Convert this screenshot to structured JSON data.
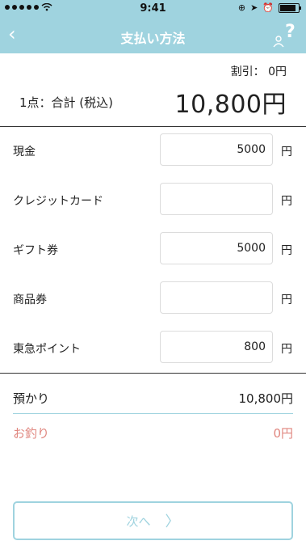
{
  "status_bar": {
    "time": "9:41"
  },
  "nav": {
    "back": "‹",
    "title": "支払い方法",
    "help": "?"
  },
  "summary": {
    "discount": "割引： 0円",
    "count_label": "1点：合計 (税込)",
    "total": "10,800円"
  },
  "payments": [
    {
      "label": "現金",
      "value": "5000",
      "unit": "円"
    },
    {
      "label": "クレジットカード",
      "value": "",
      "unit": "円"
    },
    {
      "label": "ギフト券",
      "value": "5000",
      "unit": "円"
    },
    {
      "label": "商品券",
      "value": "",
      "unit": "円"
    },
    {
      "label": "東急ポイント",
      "value": "800",
      "unit": "円"
    }
  ],
  "deposit": {
    "label": "預かり",
    "value": "10,800円"
  },
  "change": {
    "label": "お釣り",
    "value": "0円"
  },
  "next_button": {
    "label": "次へ",
    "chevron": "〉"
  },
  "colors": {
    "accent": "#9fd3df",
    "change": "#e0867f"
  }
}
